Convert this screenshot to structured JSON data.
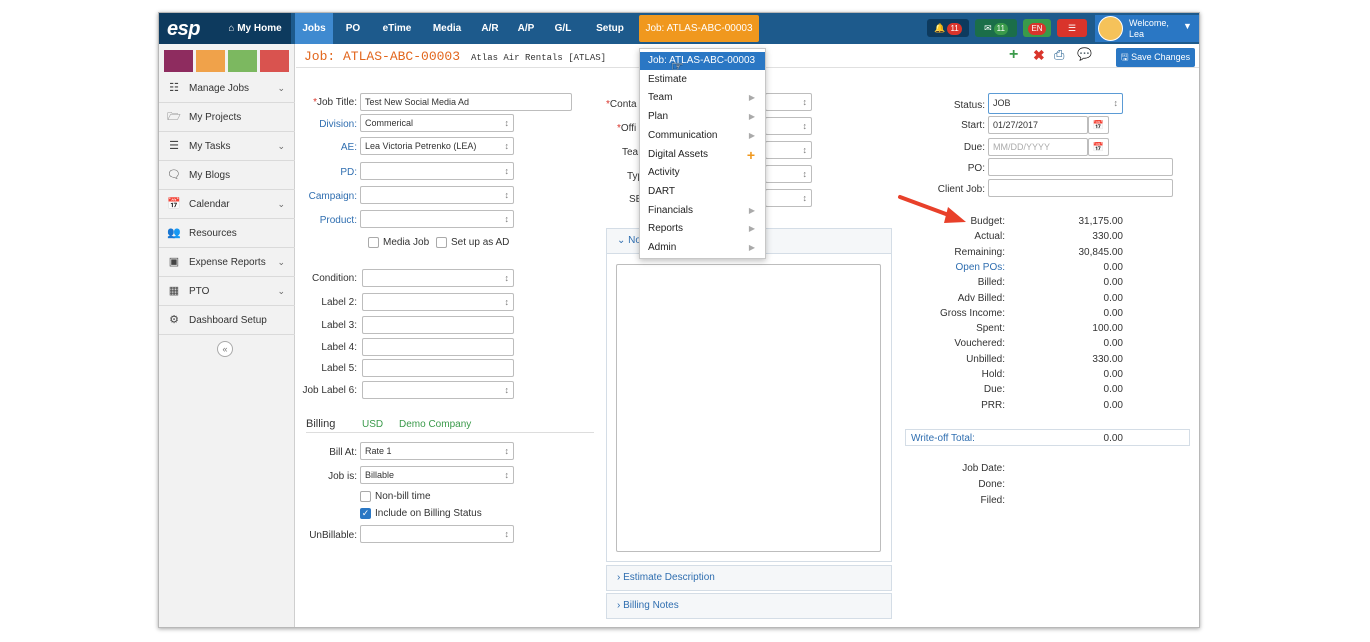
{
  "nav": {
    "logo": "esp",
    "items": [
      "My Home",
      "Jobs",
      "PO",
      "eTime",
      "Media",
      "A/R",
      "A/P",
      "G/L",
      "Setup"
    ],
    "job_context": "Job: ATLAS-ABC-00003",
    "notifications_count": "11",
    "messages_count": "11",
    "language": "EN",
    "welcome": "Welcome,",
    "user": "Lea"
  },
  "sidebar": {
    "swatch_colors": [
      "#8e2c5f",
      "#f0a24a",
      "#7cb860",
      "#d9534f"
    ],
    "items": [
      {
        "label": "Manage Jobs",
        "icon": "sitemap-icon",
        "chevron": true
      },
      {
        "label": "My Projects",
        "icon": "folder-icon",
        "chevron": false
      },
      {
        "label": "My Tasks",
        "icon": "tasks-icon",
        "chevron": true
      },
      {
        "label": "My Blogs",
        "icon": "comment-icon",
        "chevron": false
      },
      {
        "label": "Calendar",
        "icon": "calendar-icon",
        "chevron": true
      },
      {
        "label": "Resources",
        "icon": "users-icon",
        "chevron": false
      },
      {
        "label": "Expense Reports",
        "icon": "money-icon",
        "chevron": true
      },
      {
        "label": "PTO",
        "icon": "calendar-grid-icon",
        "chevron": true
      },
      {
        "label": "Dashboard Setup",
        "icon": "cogs-icon",
        "chevron": false
      }
    ],
    "collapse": "«"
  },
  "header": {
    "job_title": "Job: ATLAS-ABC-00003",
    "client": "Atlas Air Rentals [ATLAS]",
    "save_label": "Save Changes"
  },
  "form": {
    "job_title_label": "*Job Title:",
    "job_title_value": "Test New Social Media Ad",
    "division_label": "Division:",
    "division_value": "Commerical",
    "ae_label": "AE:",
    "ae_value": "Lea Victoria Petrenko (LEA)",
    "pd_label": "PD:",
    "campaign_label": "Campaign:",
    "product_label": "Product:",
    "media_job": "Media Job",
    "set_up_as_ad": "Set up as AD",
    "condition_label": "Condition:",
    "label2": "Label 2:",
    "label3": "Label 3:",
    "label4": "Label 4:",
    "label5": "Label 5:",
    "job_label6": "Job Label 6:"
  },
  "billing": {
    "title": "Billing",
    "currency": "USD",
    "company": "Demo Company",
    "bill_at_label": "Bill At:",
    "bill_at_value": "Rate 1",
    "job_is_label": "Job is:",
    "job_is_value": "Billable",
    "non_bill_time": "Non-bill time",
    "include_billing_status": "Include on Billing Status",
    "unbillable_label": "UnBillable:"
  },
  "middle": {
    "contact_label": "*Conta",
    "office_label": "*Offi",
    "team_label": "Tea",
    "type_label": "Typ",
    "sb_label": "SB",
    "notes_head": "No",
    "estimate_description": "Estimate Description",
    "billing_notes": "Billing Notes"
  },
  "dropdown": [
    {
      "label": "Job: ATLAS-ABC-00003",
      "arrow": false,
      "highlight": true
    },
    {
      "label": "Estimate",
      "arrow": false
    },
    {
      "label": "Team",
      "arrow": true
    },
    {
      "label": "Plan",
      "arrow": true
    },
    {
      "label": "Communication",
      "arrow": true
    },
    {
      "label": "Digital Assets",
      "arrow": false,
      "plus": true
    },
    {
      "label": "Activity",
      "arrow": false
    },
    {
      "label": "DART",
      "arrow": false
    },
    {
      "label": "Financials",
      "arrow": true
    },
    {
      "label": "Reports",
      "arrow": true
    },
    {
      "label": "Admin",
      "arrow": true
    }
  ],
  "status": {
    "status_label": "Status:",
    "status_value": "JOB",
    "start_label": "Start:",
    "start_value": "01/27/2017",
    "due_label": "Due:",
    "due_placeholder": "MM/DD/YYYY",
    "po_label": "PO:",
    "client_job_label": "Client Job:"
  },
  "financials": [
    {
      "label": "Budget:",
      "value": "31,175.00",
      "blue": false
    },
    {
      "label": "Actual:",
      "value": "330.00",
      "blue": false
    },
    {
      "label": "Remaining:",
      "value": "30,845.00",
      "blue": false
    },
    {
      "label": "Open POs:",
      "value": "0.00",
      "blue": true
    },
    {
      "label": "Billed:",
      "value": "0.00",
      "blue": false
    },
    {
      "label": "Adv Billed:",
      "value": "0.00",
      "blue": false
    },
    {
      "label": "Gross Income:",
      "value": "0.00",
      "blue": false
    },
    {
      "label": "Spent:",
      "value": "100.00",
      "blue": false
    },
    {
      "label": "Vouchered:",
      "value": "0.00",
      "blue": false
    },
    {
      "label": "Unbilled:",
      "value": "330.00",
      "blue": false
    },
    {
      "label": "Hold:",
      "value": "0.00",
      "blue": false
    },
    {
      "label": "Due:",
      "value": "0.00",
      "blue": false
    },
    {
      "label": "PRR:",
      "value": "0.00",
      "blue": false
    }
  ],
  "writeoff": {
    "label": "Write-off Total:",
    "value": "0.00"
  },
  "dates": {
    "job_date": "Job Date:",
    "done": "Done:",
    "filed": "Filed:"
  }
}
